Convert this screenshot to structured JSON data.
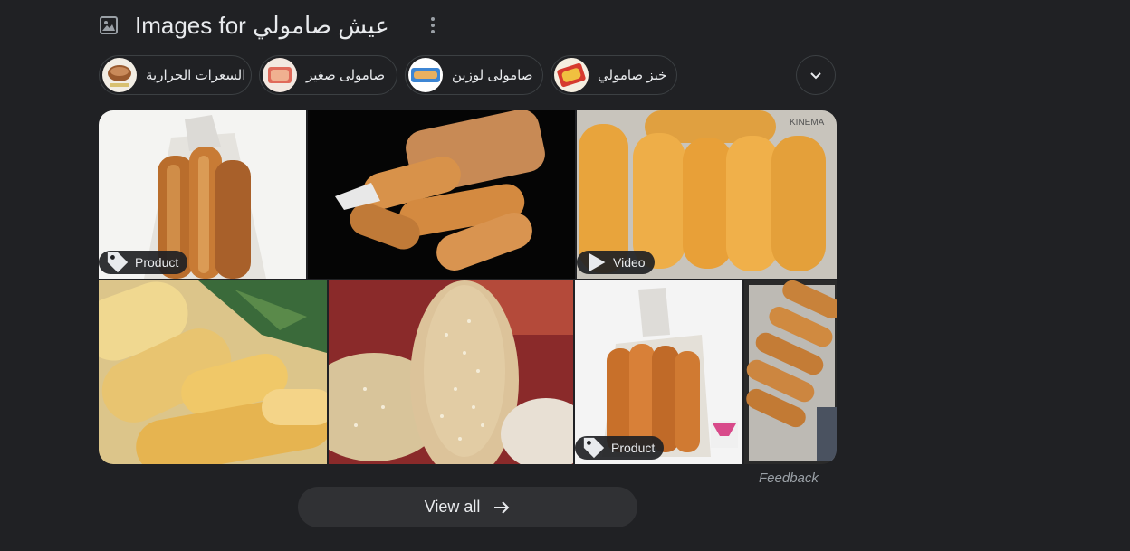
{
  "header": {
    "title": "Images for عيش صامولي",
    "icon": "image-icon",
    "menu_icon": "more-vert-icon"
  },
  "chips": [
    {
      "label": "السعرات الحرارية",
      "thumb_color": "#c98a5a"
    },
    {
      "label": "صامولى صغير",
      "thumb_color": "#d98a6a"
    },
    {
      "label": "صامولى لوزين",
      "thumb_color": "#4a8fd6"
    },
    {
      "label": "خبز صامولي",
      "thumb_color": "#e0b040"
    }
  ],
  "expand_icon": "chevron-down-icon",
  "images": [
    {
      "badge": "Product",
      "badge_icon": "tag-icon"
    },
    {
      "badge": ""
    },
    {
      "badge": "Video",
      "badge_icon": "play-icon"
    },
    {
      "badge": ""
    },
    {
      "badge": ""
    },
    {
      "badge": "Product",
      "badge_icon": "tag-icon"
    },
    {
      "badge": ""
    }
  ],
  "feedback": "Feedback",
  "view_all": {
    "label": "View all",
    "icon": "arrow-right-icon"
  },
  "colors": {
    "background": "#202124",
    "surface": "#303134",
    "border": "#3c4043",
    "text": "#e8eaed",
    "muted": "#9aa0a6"
  }
}
